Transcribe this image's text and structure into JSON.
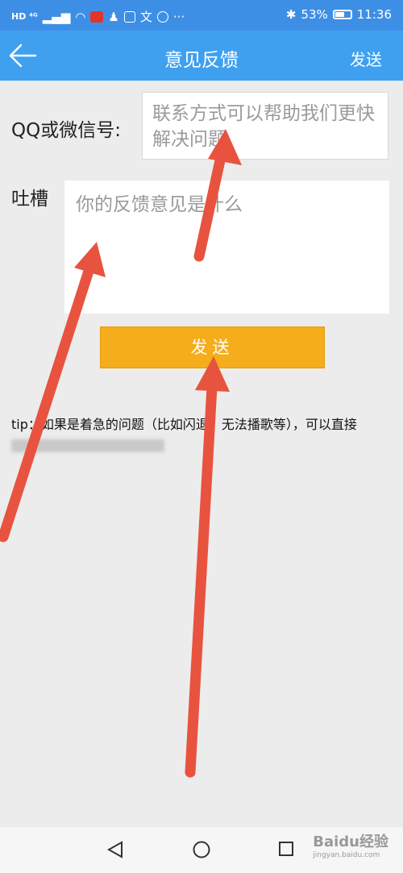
{
  "status_bar": {
    "left_text": "HD ⁴ᴳ",
    "battery": "53%",
    "time": "11:36"
  },
  "header": {
    "title": "意见反馈",
    "send_label": "发送"
  },
  "form": {
    "contact_label": "QQ或微信号:",
    "contact_placeholder": "联系方式可以帮助我们更快解决问题",
    "feedback_label": "吐槽",
    "feedback_placeholder": "你的反馈意见是什么",
    "submit_label": "发送"
  },
  "tip": {
    "text_before": "tip：如果是着急的问题（比如闪退、无法播歌等），可以直接"
  },
  "watermark": {
    "brand": "Baidu经验",
    "url": "jingyan.baidu.com"
  },
  "colors": {
    "nav_bar": "#3fa0f0",
    "submit_button": "#f5ad1b",
    "annotation_arrow": "#e8533f"
  }
}
